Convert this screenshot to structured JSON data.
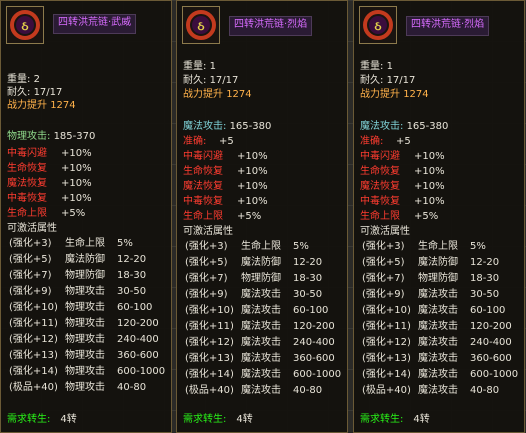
{
  "colors": {
    "name": "#d86cff",
    "power": "#ffb14a",
    "physical": "#8fd88a",
    "magic": "#7fd3d8",
    "bonus": "#ff3c30",
    "requirement": "#28f018"
  },
  "icon": "purple-chain-necklace-icon",
  "panels": [
    {
      "name": "四转洪荒链·武威",
      "weight_label": "重量:",
      "weight": "2",
      "durability_label": "耐久:",
      "durability": "17/17",
      "power_label": "战力提升",
      "power": "1274",
      "main_stat": {
        "label": "物理攻击:",
        "value": "185-370"
      },
      "bonuses": [
        {
          "label": "中毒闪避",
          "value": "+10%"
        },
        {
          "label": "生命恢复",
          "value": "+10%"
        },
        {
          "label": "魔法恢复",
          "value": "+10%"
        },
        {
          "label": "中毒恢复",
          "value": "+10%"
        },
        {
          "label": "生命上限",
          "value": "+5%"
        }
      ],
      "activatable_label": "可激活属性",
      "enhancements": [
        {
          "level": "(强化+3)",
          "stat": "生命上限",
          "value": "5%"
        },
        {
          "level": "(强化+5)",
          "stat": "魔法防御",
          "value": "12-20"
        },
        {
          "level": "(强化+7)",
          "stat": "物理防御",
          "value": "18-30"
        },
        {
          "level": "(强化+9)",
          "stat": "物理攻击",
          "value": "30-50"
        },
        {
          "level": "(强化+10)",
          "stat": "物理攻击",
          "value": "60-100"
        },
        {
          "level": "(强化+11)",
          "stat": "物理攻击",
          "value": "120-200"
        },
        {
          "level": "(强化+12)",
          "stat": "物理攻击",
          "value": "240-400"
        },
        {
          "level": "(强化+13)",
          "stat": "物理攻击",
          "value": "360-600"
        },
        {
          "level": "(强化+14)",
          "stat": "物理攻击",
          "value": "600-1000"
        },
        {
          "level": "(极品+40)",
          "stat": "物理攻击",
          "value": "40-80"
        }
      ],
      "requirement_label": "需求转生:",
      "requirement": "4转"
    },
    {
      "name": "四转洪荒链·烈焰",
      "weight_label": "重量:",
      "weight": "1",
      "durability_label": "耐久:",
      "durability": "17/17",
      "power_label": "战力提升",
      "power": "1274",
      "main_stat": {
        "label": "魔法攻击:",
        "value": "165-380"
      },
      "accuracy": {
        "label": "准确:",
        "value": "+5"
      },
      "bonuses": [
        {
          "label": "中毒闪避",
          "value": "+10%"
        },
        {
          "label": "生命恢复",
          "value": "+10%"
        },
        {
          "label": "魔法恢复",
          "value": "+10%"
        },
        {
          "label": "中毒恢复",
          "value": "+10%"
        },
        {
          "label": "生命上限",
          "value": "+5%"
        }
      ],
      "activatable_label": "可激活属性",
      "enhancements": [
        {
          "level": "(强化+3)",
          "stat": "生命上限",
          "value": "5%"
        },
        {
          "level": "(强化+5)",
          "stat": "魔法防御",
          "value": "12-20"
        },
        {
          "level": "(强化+7)",
          "stat": "物理防御",
          "value": "18-30"
        },
        {
          "level": "(强化+9)",
          "stat": "魔法攻击",
          "value": "30-50"
        },
        {
          "level": "(强化+10)",
          "stat": "魔法攻击",
          "value": "60-100"
        },
        {
          "level": "(强化+11)",
          "stat": "魔法攻击",
          "value": "120-200"
        },
        {
          "level": "(强化+12)",
          "stat": "魔法攻击",
          "value": "240-400"
        },
        {
          "level": "(强化+13)",
          "stat": "魔法攻击",
          "value": "360-600"
        },
        {
          "level": "(强化+14)",
          "stat": "魔法攻击",
          "value": "600-1000"
        },
        {
          "level": "(极品+40)",
          "stat": "魔法攻击",
          "value": "40-80"
        }
      ],
      "requirement_label": "需求转生:",
      "requirement": "4转"
    },
    {
      "name": "四转洪荒链·烈焰",
      "weight_label": "重量:",
      "weight": "1",
      "durability_label": "耐久:",
      "durability": "17/17",
      "power_label": "战力提升",
      "power": "1274",
      "main_stat": {
        "label": "魔法攻击:",
        "value": "165-380"
      },
      "accuracy": {
        "label": "准确:",
        "value": "+5"
      },
      "bonuses": [
        {
          "label": "中毒闪避",
          "value": "+10%"
        },
        {
          "label": "生命恢复",
          "value": "+10%"
        },
        {
          "label": "魔法恢复",
          "value": "+10%"
        },
        {
          "label": "中毒恢复",
          "value": "+10%"
        },
        {
          "label": "生命上限",
          "value": "+5%"
        }
      ],
      "activatable_label": "可激活属性",
      "enhancements": [
        {
          "level": "(强化+3)",
          "stat": "生命上限",
          "value": "5%"
        },
        {
          "level": "(强化+5)",
          "stat": "魔法防御",
          "value": "12-20"
        },
        {
          "level": "(强化+7)",
          "stat": "物理防御",
          "value": "18-30"
        },
        {
          "level": "(强化+9)",
          "stat": "魔法攻击",
          "value": "30-50"
        },
        {
          "level": "(强化+10)",
          "stat": "魔法攻击",
          "value": "60-100"
        },
        {
          "level": "(强化+11)",
          "stat": "魔法攻击",
          "value": "120-200"
        },
        {
          "level": "(强化+12)",
          "stat": "魔法攻击",
          "value": "240-400"
        },
        {
          "level": "(强化+13)",
          "stat": "魔法攻击",
          "value": "360-600"
        },
        {
          "level": "(强化+14)",
          "stat": "魔法攻击",
          "value": "600-1000"
        },
        {
          "level": "(极品+40)",
          "stat": "魔法攻击",
          "value": "40-80"
        }
      ],
      "requirement_label": "需求转生:",
      "requirement": "4转"
    }
  ]
}
